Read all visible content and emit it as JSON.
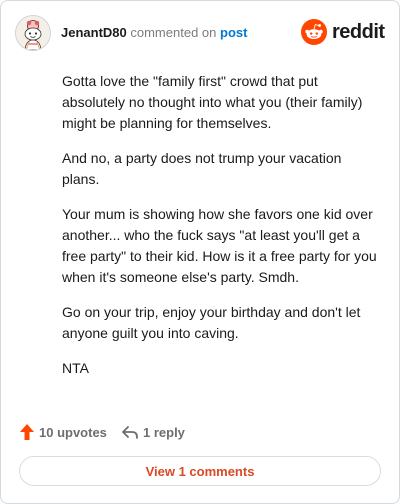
{
  "header": {
    "username": "JenantD80",
    "commented_on": "commented on",
    "post_link": "post",
    "logo_text": "reddit",
    "avatar_icon": "snoo-avatar-icon",
    "logo_icon": "reddit-snoo-icon"
  },
  "comment": {
    "paragraphs": [
      "Gotta love the \"family first\" crowd that put absolutely no thought into what you (their family) might be planning for themselves.",
      "And no, a party does not trump your vacation plans.",
      "Your mum is showing how she favors one kid over another... who the fuck says \"at least you'll get a free party\" to their kid. How is it a free party for you when it's someone else's party. Smdh.",
      "Go on your trip, enjoy your birthday and don't let anyone guilt you into caving.",
      "NTA"
    ]
  },
  "actions": {
    "upvotes_label": "10 upvotes",
    "replies_label": "1 reply",
    "upvote_icon": "upvote-arrow-icon",
    "reply_icon": "reply-arrow-icon"
  },
  "footer": {
    "view_comments_label": "View 1 comments"
  },
  "colors": {
    "accent": "#d94a25",
    "link": "#0079d3",
    "reddit_orange": "#ff4500",
    "muted": "#6b6f72",
    "border": "#d5dadc"
  }
}
